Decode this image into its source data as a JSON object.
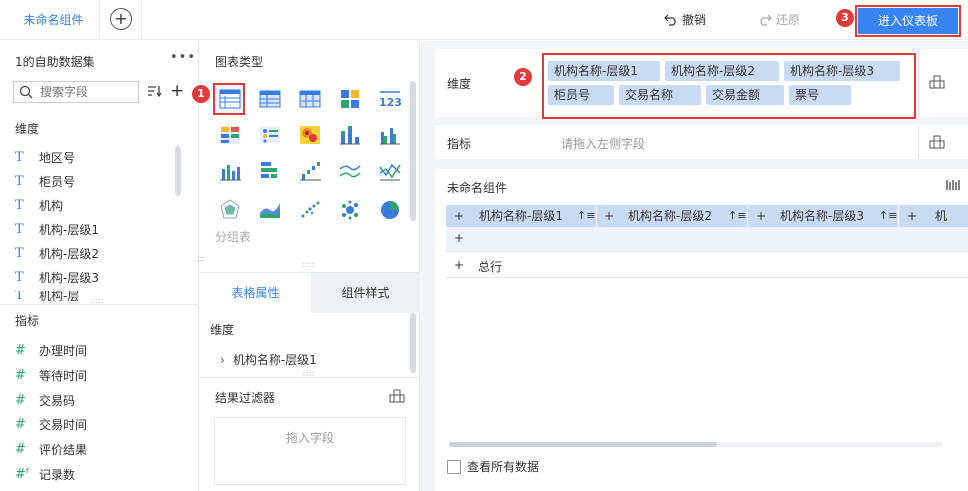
{
  "topbar": {
    "tab_label": "未命名组件",
    "undo_label": "撤销",
    "redo_label": "还原",
    "dashboard_button": "进入仪表板"
  },
  "badges": [
    "1",
    "2",
    "3"
  ],
  "left_panel": {
    "dataset_title": "1的自助数据集",
    "search_placeholder": "搜索字段",
    "dimension_label": "维度",
    "dimensions": [
      "地区号",
      "柜员号",
      "机构",
      "机构-层级1",
      "机构-层级2",
      "机构-层级3",
      "机构-层"
    ],
    "measure_label": "指标",
    "measures": [
      "办理时间",
      "等待时间",
      "交易码",
      "交易时间",
      "评价结果",
      "记录数"
    ]
  },
  "chart_panel": {
    "title": "图表类型",
    "group_label": "分组表",
    "tabs": [
      "表格属性",
      "组件样式"
    ],
    "dimension_label": "维度",
    "dimension_item": "机构名称-层级1",
    "filter_title": "结果过滤器",
    "filter_placeholder": "拖入字段"
  },
  "editor": {
    "dimension_label": "维度",
    "dimension_chips": [
      "机构名称-层级1",
      "机构名称-层级2",
      "机构名称-层级3",
      "柜员号",
      "交易名称",
      "交易金额",
      "票号"
    ],
    "measure_label": "指标",
    "measure_placeholder": "请拖入左侧字段",
    "component_title": "未命名组件",
    "table_headers": [
      "机构名称-层级1",
      "机构名称-层级2",
      "机构名称-层级3",
      "机"
    ],
    "total_label": "总行",
    "view_all_label": "查看所有数据"
  },
  "colors": {
    "accent": "#3685f2",
    "highlight": "#e03a3a",
    "chip_bg": "#c9daf5"
  }
}
